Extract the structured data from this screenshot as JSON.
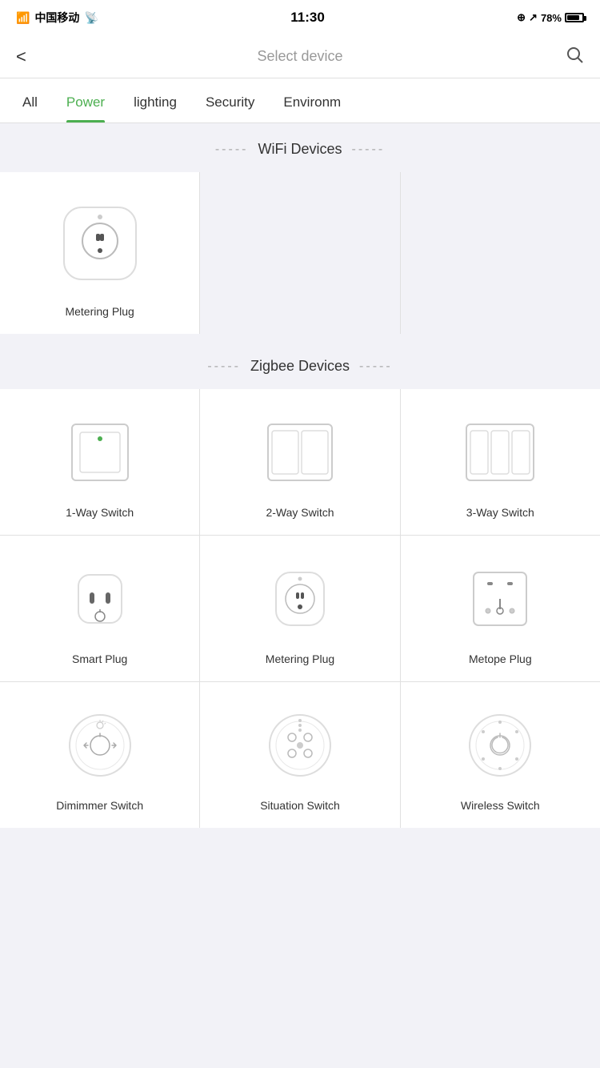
{
  "statusBar": {
    "carrier": "中国移动",
    "time": "11:30",
    "battery": "78%"
  },
  "navBar": {
    "backLabel": "<",
    "title": "Select device",
    "searchLabel": "⌕"
  },
  "tabs": [
    {
      "id": "all",
      "label": "All",
      "active": false
    },
    {
      "id": "power",
      "label": "Power",
      "active": true
    },
    {
      "id": "lighting",
      "label": "lighting",
      "active": false
    },
    {
      "id": "security",
      "label": "Security",
      "active": false
    },
    {
      "id": "environment",
      "label": "Environm",
      "active": false
    }
  ],
  "wifiSection": {
    "dashes": "-----",
    "title": "WiFi Devices",
    "devices": [
      {
        "id": "metering-plug-wifi",
        "label": "Metering Plug",
        "icon": "metering-plug"
      }
    ]
  },
  "zigbeeSection": {
    "dashes": "-----",
    "title": "Zigbee Devices",
    "devices": [
      {
        "id": "1way-switch",
        "label": "1-Way Switch",
        "icon": "switch-1"
      },
      {
        "id": "2way-switch",
        "label": "2-Way Switch",
        "icon": "switch-2"
      },
      {
        "id": "3way-switch",
        "label": "3-Way Switch",
        "icon": "switch-3"
      },
      {
        "id": "smart-plug",
        "label": "Smart Plug",
        "icon": "smart-plug"
      },
      {
        "id": "metering-plug-zb",
        "label": "Metering Plug",
        "icon": "metering-plug-round"
      },
      {
        "id": "metope-plug",
        "label": "Metope Plug",
        "icon": "metope-plug"
      },
      {
        "id": "dimmer-switch",
        "label": "Dimimmer Switch",
        "icon": "dimmer-switch"
      },
      {
        "id": "situation-switch",
        "label": "Situation Switch",
        "icon": "situation-switch"
      },
      {
        "id": "wireless-switch",
        "label": "Wireless Switch",
        "icon": "wireless-switch"
      }
    ]
  }
}
